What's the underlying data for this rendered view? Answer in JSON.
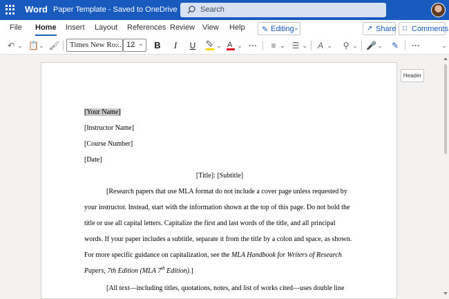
{
  "app": {
    "name": "Word",
    "document_title": "Paper Template",
    "save_status": "Saved to OneDrive",
    "search_placeholder": "Search"
  },
  "ribbon_tabs": [
    "File",
    "Home",
    "Insert",
    "Layout",
    "References",
    "Review",
    "View",
    "Help"
  ],
  "active_tab": "Home",
  "mode_button": "Editing",
  "share_button": "Share",
  "comments_button": "Comments",
  "toolbar": {
    "font_family": "Times New Ro...",
    "font_size": "12",
    "bold": "B",
    "italic": "I",
    "underline": "U",
    "more": "···"
  },
  "header_button": "Header",
  "document": {
    "your_name": "[Your Name]",
    "instructor": "[Instructor Name]",
    "course": "[Course Number]",
    "date": "[Date]",
    "title": "[Title]: [Subtitle]",
    "para1_l1": "[Research papers that use MLA format do not include a cover page unless requested by",
    "para1_l2": "your instructor. Instead, start with the information shown at the top of this page.  Do not bold the",
    "para1_l3": "title or use all capital letters. Capitalize the first and last words of the title, and all principal",
    "para1_l4": "words. If your paper includes a subtitle, separate it from the title by a colon and space, as shown.",
    "para1_l5a": "For more specific guidance on capitalization, see the ",
    "para1_l5b": "MLA Handbook for Writers of Research",
    "para1_l6a": "Papers, 7th Edition (MLA 7",
    "para1_l6sup": "th",
    "para1_l6b": " Edition)",
    "para1_l6c": ".]",
    "para2_l1": "[All text—including titles, quotations, notes, and list of works cited—uses double line"
  },
  "colors": {
    "title_bar": "#185abd",
    "accent": "#185abd",
    "highlight": "#ffd700",
    "font_color": "#e81123"
  }
}
